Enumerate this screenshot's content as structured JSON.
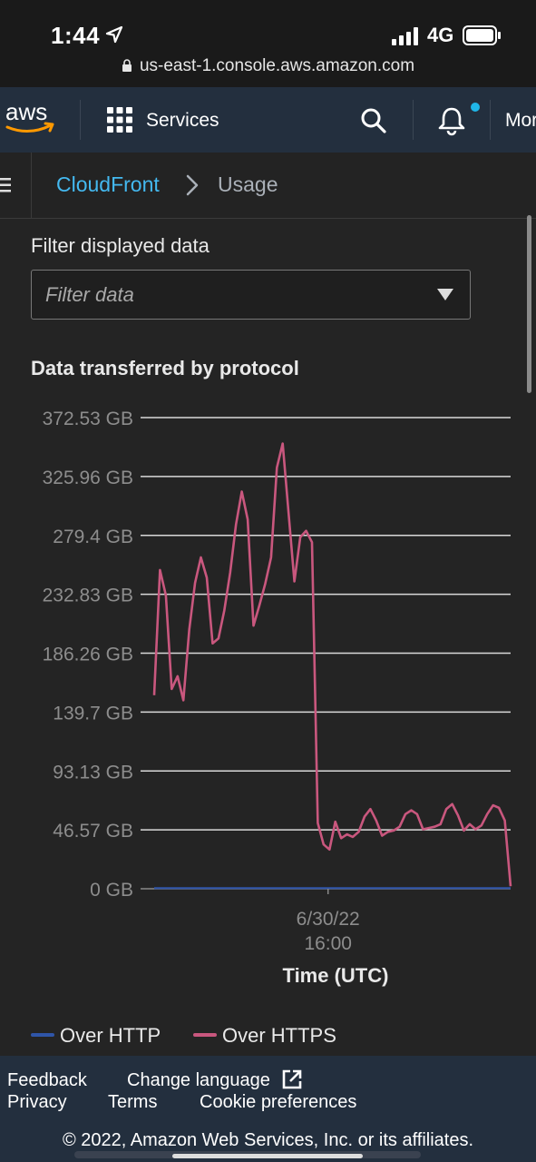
{
  "status_bar": {
    "time": "1:44",
    "network": "4G",
    "url": "us-east-1.console.aws.amazon.com"
  },
  "top_nav": {
    "logo_text": "aws",
    "services_label": "Services",
    "more_label": "More",
    "accent_color": "#ff9900",
    "notification_dot_color": "#1fb6e8"
  },
  "breadcrumb": {
    "parent": "CloudFront",
    "current": "Usage"
  },
  "filter": {
    "label": "Filter displayed data",
    "placeholder": "Filter data"
  },
  "chart_title": "Data transferred by protocol",
  "chart_data": {
    "type": "line",
    "title": "Data transferred by protocol",
    "xlabel": "Time (UTC)",
    "ylabel": "",
    "y_ticks": [
      "372.53 GB",
      "325.96 GB",
      "279.4 GB",
      "232.83 GB",
      "186.26 GB",
      "139.7 GB",
      "93.13 GB",
      "46.57 GB",
      "0 GB"
    ],
    "ylim": [
      0,
      372.53
    ],
    "x_tick": {
      "line1": "6/30/22",
      "line2": "16:00",
      "index": 31
    },
    "grid": true,
    "legend_position": "bottom",
    "series": [
      {
        "name": "Over HTTP",
        "color": "#2f55a8",
        "values": [
          0.5,
          0.5,
          0.5,
          0.5,
          0.5,
          0.5,
          0.5,
          0.5,
          0.5,
          0.5,
          0.5,
          0.5,
          0.5,
          0.5,
          0.5,
          0.5,
          0.5,
          0.5,
          0.5,
          0.5,
          0.5,
          0.5,
          0.5,
          0.5,
          0.5,
          0.5,
          0.5,
          0.5,
          0.5,
          0.5,
          0.5,
          0.5,
          0.5,
          0.5,
          0.5,
          0.5,
          0.5,
          0.5,
          0.5,
          0.5,
          0.5,
          0.5,
          0.5,
          0.5,
          0.5,
          0.5,
          0.5,
          0.5,
          0.5,
          0.5,
          0.5,
          0.5,
          0.5,
          0.5,
          0.5,
          0.5,
          0.5,
          0.5,
          0.5,
          0.5,
          0.5,
          0.5,
          0.5,
          0.5
        ]
      },
      {
        "name": "Over HTTPS",
        "color": "#c9577e",
        "values": [
          153,
          252,
          232,
          158,
          168,
          149,
          205,
          242,
          262,
          246,
          194,
          198,
          220,
          250,
          288,
          314,
          292,
          208,
          224,
          241,
          262,
          333,
          352,
          297,
          243,
          278,
          283,
          274,
          52,
          35,
          31,
          53,
          40,
          43,
          41,
          45,
          57,
          63,
          54,
          42,
          45,
          46,
          49,
          59,
          62,
          59,
          47,
          48,
          49,
          51,
          63,
          67,
          58,
          46,
          51,
          47,
          50,
          59,
          66,
          64,
          54,
          2
        ]
      }
    ]
  },
  "legend": {
    "http": "Over HTTP",
    "https": "Over HTTPS"
  },
  "footer": {
    "feedback": "Feedback",
    "change_language": "Change language",
    "privacy": "Privacy",
    "terms": "Terms",
    "cookie": "Cookie preferences",
    "copyright": "© 2022, Amazon Web Services, Inc. or its affiliates."
  }
}
